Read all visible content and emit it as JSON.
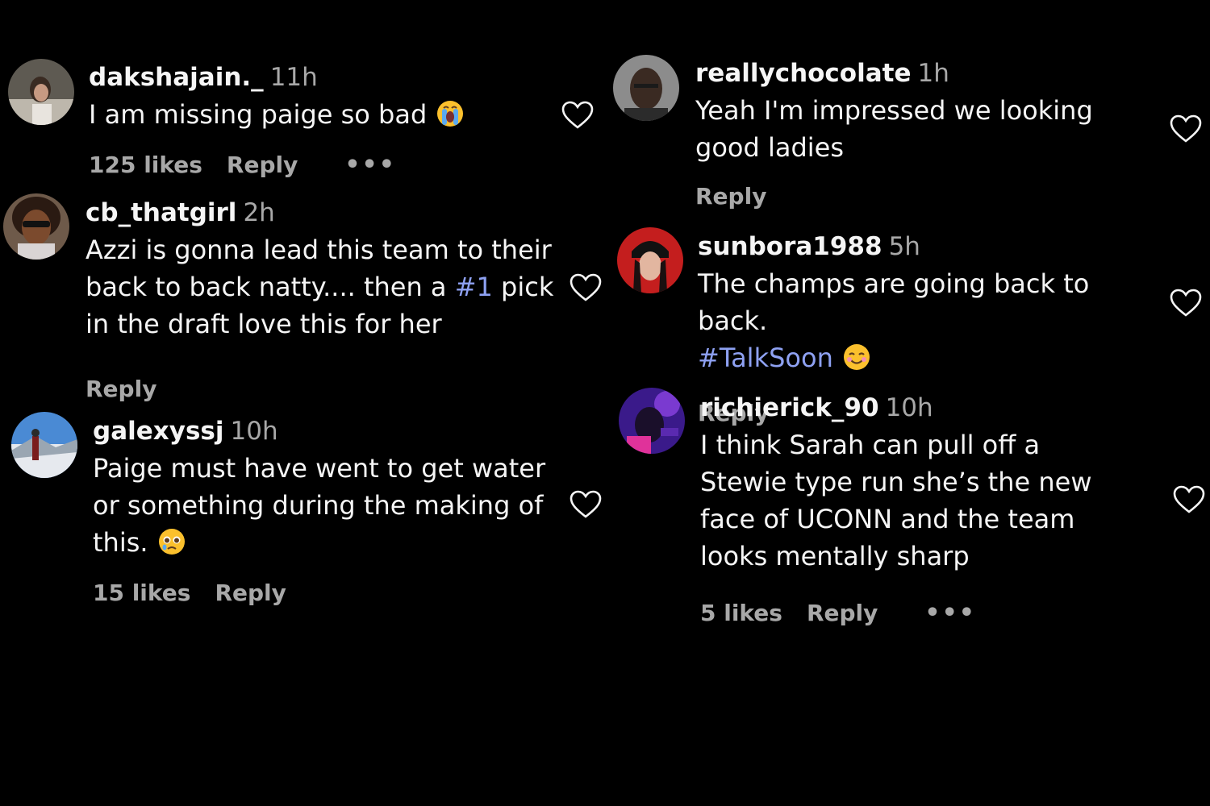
{
  "colors": {
    "background": "#000000",
    "text_primary": "#f5f5f5",
    "text_secondary": "#a8a8a8",
    "hashtag": "#8ea1f2"
  },
  "comments": [
    {
      "username": "dakshajain._",
      "time": "11h",
      "text": "I am missing paige so bad",
      "emoji": "loudly-crying-face",
      "likes": "125 likes",
      "reply": "Reply",
      "more": "•••"
    },
    {
      "username": "cb_thatgirl",
      "time": "2h",
      "text_a": "Azzi is gonna lead this team to their back to back natty.... then a ",
      "hashtag": "#1",
      "text_b": " pick in the draft love this for her",
      "reply": "Reply"
    },
    {
      "username": "galexyssj",
      "time": "10h",
      "text": "Paige must have went to get water or something during the making of this.",
      "emoji": "pleading-face",
      "likes": "15 likes",
      "reply": "Reply"
    },
    {
      "username": "reallychocolate",
      "time": "1h",
      "text": "Yeah I'm impressed we looking good ladies",
      "reply": "Reply"
    },
    {
      "username": "sunbora1988",
      "time": "5h",
      "text": "The champs are going back to back.",
      "hashtag": "#TalkSoon",
      "emoji": "smiling-face",
      "reply": "Reply"
    },
    {
      "username": "richierick_90",
      "time": "10h",
      "text": "I think Sarah can pull off a Stewie type run she’s the new face of UCONN and the team looks mentally sharp",
      "likes": "5 likes",
      "reply": "Reply",
      "more": "•••"
    }
  ]
}
